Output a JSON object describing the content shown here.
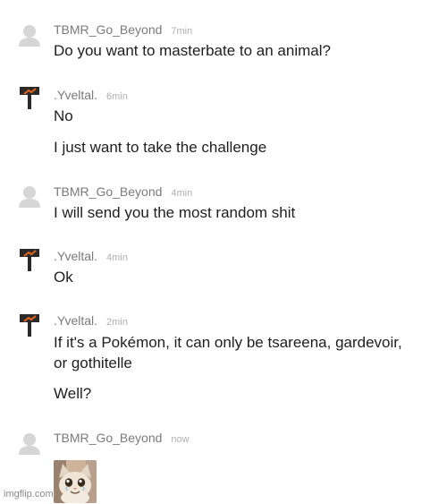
{
  "messages": [
    {
      "user": "TBMR_Go_Beyond",
      "time": "7min",
      "lines": [
        "Do you want to masterbate to an animal?"
      ]
    },
    {
      "user": ".Yveltal.",
      "time": "6min",
      "lines": [
        "No",
        "I just want to take the challenge"
      ]
    },
    {
      "user": "TBMR_Go_Beyond",
      "time": "4min",
      "lines": [
        "I will send you the most random shit"
      ]
    },
    {
      "user": ".Yveltal.",
      "time": "4min",
      "lines": [
        "Ok"
      ]
    },
    {
      "user": ".Yveltal.",
      "time": "2min",
      "lines": [
        "If it's a Pokémon, it can only be tsareena, gardevoir,",
        "or gothitelle",
        "Well?"
      ]
    },
    {
      "user": "TBMR_Go_Beyond",
      "time": "now",
      "sticker": "crying-cat-sticker"
    }
  ],
  "watermark": "imgflip.com",
  "colors": {
    "username": "#7a7a7a",
    "timestamp": "#b0b0b0",
    "text": "#1e1e1e",
    "default_avatar": "#d6d6d6",
    "hammer_accent": "#e8651e"
  }
}
